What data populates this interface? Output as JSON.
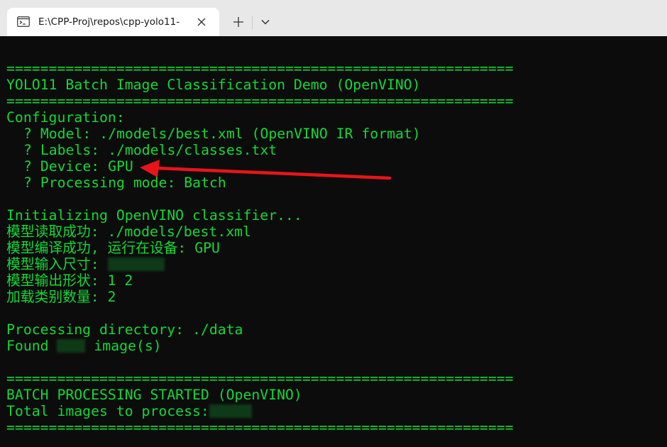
{
  "tab": {
    "title": "E:\\CPP-Proj\\repos\\cpp-yolo11-",
    "icon": "terminal-icon",
    "close_icon": "close-icon",
    "new_tab_icon": "plus-icon",
    "dropdown_icon": "chevron-down-icon"
  },
  "terminal": {
    "text_color": "#13d836",
    "background": "#0c0c0c",
    "separator": "============================================================",
    "title": "YOLO11 Batch Image Classification Demo (OpenVINO)",
    "config_header": "Configuration:",
    "config_items": [
      "? Model: ./models/best.xml (OpenVINO IR format)",
      "? Labels: ./models/classes.txt",
      "? Device: GPU",
      "? Processing mode: Batch"
    ],
    "init_msg": "Initializing OpenVINO classifier...",
    "model_loaded": "模型读取成功: ./models/best.xml",
    "model_compiled": "模型编译成功, 运行在设备: GPU",
    "input_size_prefix": "模型输入尺寸: ",
    "output_shape": "模型输出形状: 1 2",
    "class_count": "加载类别数量: 2",
    "processing_dir": "Processing directory: ./data",
    "found_prefix": "Found ",
    "found_suffix": " image(s)",
    "batch_started": "BATCH PROCESSING STARTED (OpenVINO)",
    "total_prefix": "Total images to process:"
  },
  "annotation": {
    "arrow_color": "#e8141b"
  }
}
